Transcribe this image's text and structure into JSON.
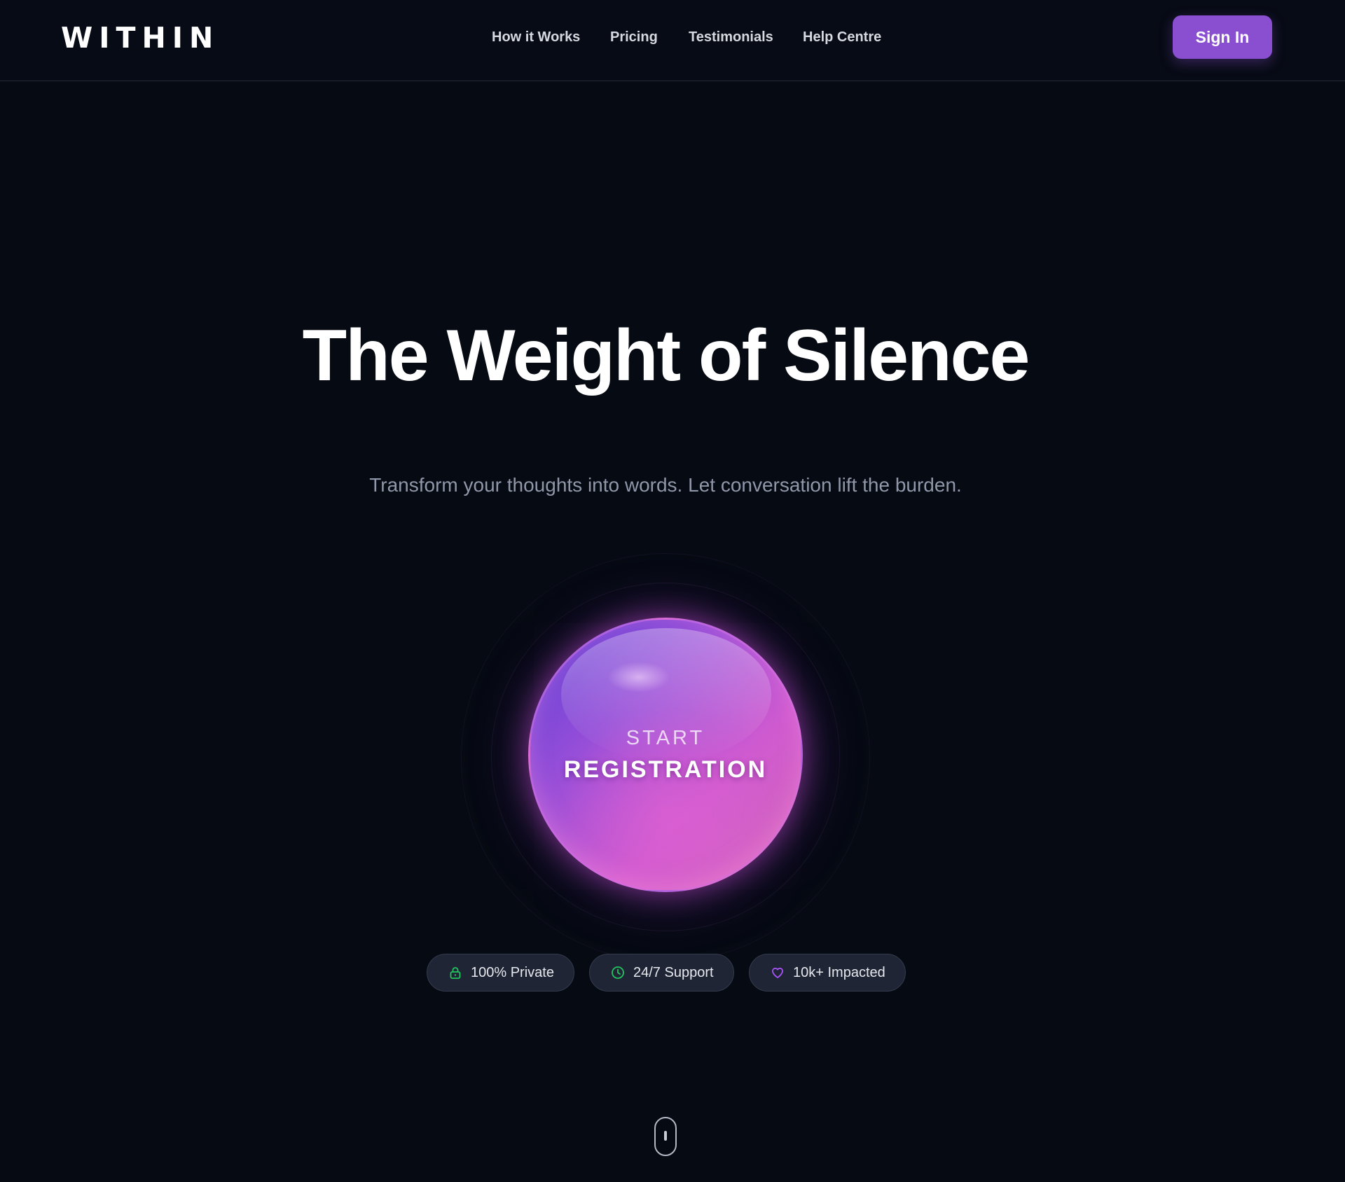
{
  "header": {
    "logo": "WITHIN",
    "nav": [
      {
        "label": "How it Works"
      },
      {
        "label": "Pricing"
      },
      {
        "label": "Testimonials"
      },
      {
        "label": "Help Centre"
      }
    ],
    "signin_label": "Sign In"
  },
  "hero": {
    "title": "The Weight of Silence",
    "subtitle": "Transform your thoughts into words. Let conversation lift the burden."
  },
  "orb": {
    "line1": "START",
    "line2": "REGISTRATION"
  },
  "badges": [
    {
      "label": "100% Private",
      "icon": "lock-icon",
      "color": "#22c55e"
    },
    {
      "label": "24/7 Support",
      "icon": "clock-icon",
      "color": "#22c55e"
    },
    {
      "label": "10k+ Impacted",
      "icon": "heart-icon",
      "color": "#a855f7"
    }
  ],
  "colors": {
    "background": "#060a13",
    "accent": "#8a4fd0",
    "orb_start": "#5a3fd6",
    "orb_end": "#d468b8"
  },
  "scroll_indicator": {
    "icon": "mouse-scroll-icon"
  }
}
